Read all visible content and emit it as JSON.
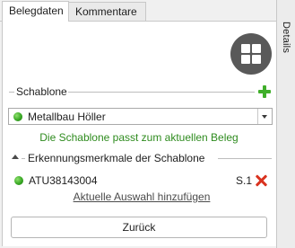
{
  "tabs": [
    {
      "label": "Belegdaten",
      "active": true
    },
    {
      "label": "Kommentare",
      "active": false
    }
  ],
  "sidebar": {
    "label": "Details"
  },
  "template_section": {
    "title": "Schablone",
    "selected_template": "Metallbau Höller",
    "status_text": "Die Schablone passt zum aktuellen Beleg"
  },
  "features_section": {
    "title": "Erkennungsmerkmale der Schablone",
    "items": [
      {
        "value": "ATU38143004",
        "page": "S.1"
      }
    ],
    "add_link": "Aktuelle Auswahl hinzufügen"
  },
  "buttons": {
    "back": "Zurück"
  },
  "colors": {
    "accent_green": "#3fae2a",
    "status_green": "#2e8b1e",
    "delete_red": "#d9321f"
  },
  "icons": {
    "grid": "grid-icon",
    "add": "plus-icon",
    "delete": "close-icon",
    "status": "green-dot-icon"
  }
}
